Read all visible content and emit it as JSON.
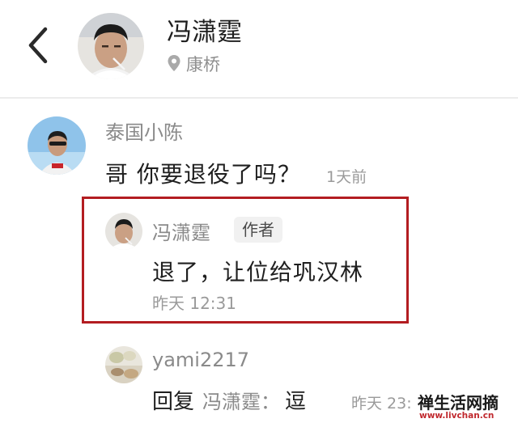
{
  "header": {
    "name": "冯潇霆",
    "location": "康桥",
    "back_icon": "chevron-left-icon",
    "location_icon": "location-pin-icon"
  },
  "comments": [
    {
      "user": "泰国小陈",
      "text": "哥 你要退役了吗？",
      "time": "1天前"
    }
  ],
  "replies": [
    {
      "user": "冯潇霆",
      "badge": "作者",
      "text": "退了，让位给巩汉林",
      "time": "昨天 12:31",
      "highlighted": true,
      "highlight_color": "#b31d21"
    },
    {
      "user": "yami2217",
      "prefix": "回复",
      "target": "冯潇霆：",
      "text": "逗",
      "time": "昨天 23:"
    }
  ],
  "watermark": {
    "text_cn": "禅生活网摘",
    "url": "www.livchan.cn"
  }
}
